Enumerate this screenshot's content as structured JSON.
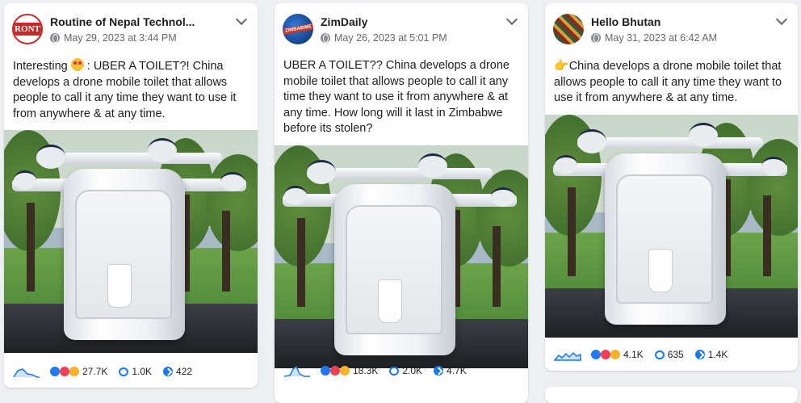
{
  "posts": [
    {
      "author": "Routine of Nepal Technol...",
      "avatar_text": "RONT",
      "date": "May 29, 2023 at 3:44 PM",
      "text_a": "Interesting",
      "text_b": " : UBER A TOILET?! China develops a drone mobile toilet that allows people to call it any time they want to use it from anywhere & at any time.",
      "reactions": "27.7K",
      "comments": "1.0K",
      "shares": "422"
    },
    {
      "author": "ZimDaily",
      "avatar_text": "ZIMBABWE",
      "date": "May 26, 2023 at 5:01 PM",
      "text_a": "UBER A TOILET?? China develops a drone mobile toilet that allows people to call it any time they want to use it from anywhere & at any time. How long will it last in Zimbabwe before its stolen?",
      "text_b": "",
      "reactions": "18.3K",
      "comments": "2.0K",
      "shares": "4.7K"
    },
    {
      "author": "Hello Bhutan",
      "date": "May 31, 2023 at 6:42 AM",
      "text_a": "China develops a drone mobile toilet that allows people to call it any time they want to use it from anywhere & at any time.",
      "text_b": "",
      "reactions": "4.1K",
      "comments": "635",
      "shares": "1.4K"
    }
  ],
  "colors": {
    "accent": "#1877f2",
    "muted": "#65676b",
    "like": "#2078f4",
    "love": "#f33e58"
  },
  "icons": [
    "globe-icon",
    "chevron-down-icon",
    "like-reaction-icon",
    "love-reaction-icon",
    "haha-reaction-icon",
    "comment-icon",
    "share-icon",
    "sparkline-icon"
  ]
}
